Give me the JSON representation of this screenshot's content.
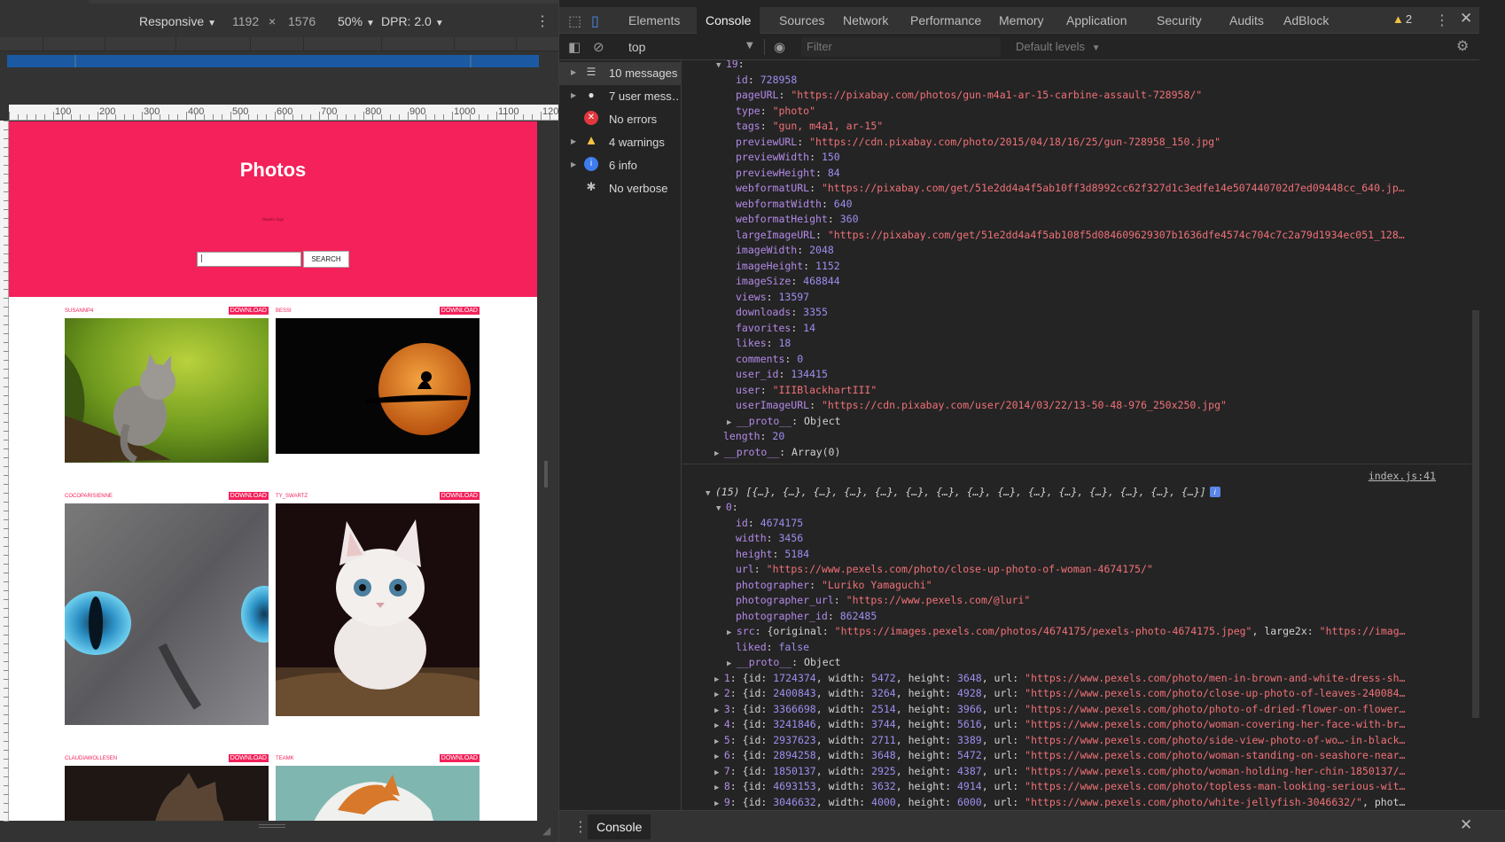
{
  "device_toolbar": {
    "mode": "Responsive",
    "width": "1192",
    "times": "×",
    "height": "1576",
    "zoom": "50%",
    "dpr": "DPR: 2.0"
  },
  "ruler": {
    "labels": [
      "100",
      "200",
      "300",
      "400",
      "500",
      "600",
      "700",
      "800",
      "900",
      "1000",
      "1100",
      "120"
    ]
  },
  "page": {
    "title": "Photos",
    "subtitle": "Header Sign",
    "search_value": "|",
    "search_button": "SEARCH",
    "download_label": "DOWNLOAD",
    "cards": [
      {
        "user": "SUSANNP4",
        "image": "kitten-on-tree"
      },
      {
        "user": "BESSI",
        "image": "cat-moon-silhouette"
      },
      {
        "user": "COCOPARISIENNE",
        "image": "cat-eye-closeup"
      },
      {
        "user": "TY_SWARTZ",
        "image": "white-kitten"
      },
      {
        "user": "CLAUDIAWOLLESEN",
        "image": "dark-cat"
      },
      {
        "user": "TEAMK",
        "image": "ginger-cat"
      }
    ]
  },
  "devtools": {
    "tabs": [
      "Elements",
      "Console",
      "Sources",
      "Network",
      "Performance",
      "Memory",
      "Application",
      "Security",
      "Audits",
      "AdBlock"
    ],
    "active_tab": "Console",
    "warning_count": "2",
    "context": "top",
    "filter_placeholder": "Filter",
    "levels": "Default levels",
    "drawer_tab": "Console"
  },
  "sidebar": {
    "items": [
      {
        "label": "10 messages",
        "icon": "list-icon"
      },
      {
        "label": "7 user mess…",
        "icon": "user-icon"
      },
      {
        "label": "No errors",
        "icon": "error-icon"
      },
      {
        "label": "4 warnings",
        "icon": "warning-icon"
      },
      {
        "label": "6 info",
        "icon": "info-icon"
      },
      {
        "label": "No verbose",
        "icon": "bug-icon"
      }
    ]
  },
  "console": {
    "source_ref": "index.js:41",
    "block1": [
      [
        "19",
        ":",
        ""
      ],
      [
        "id",
        ": ",
        "728958"
      ],
      [
        "pageURL",
        ": ",
        "\"https://pixabay.com/photos/gun-m4a1-ar-15-carbine-assault-728958/\""
      ],
      [
        "type",
        ": ",
        "\"photo\""
      ],
      [
        "tags",
        ": ",
        "\"gun, m4a1, ar-15\""
      ],
      [
        "previewURL",
        ": ",
        "\"https://cdn.pixabay.com/photo/2015/04/18/16/25/gun-728958_150.jpg\""
      ],
      [
        "previewWidth",
        ": ",
        "150"
      ],
      [
        "previewHeight",
        ": ",
        "84"
      ],
      [
        "webformatURL",
        ": ",
        "\"https://pixabay.com/get/51e2dd4a4f5ab10ff3d8992cc62f327d1c3edfe14e507440702d7ed09448cc_640.jp…"
      ],
      [
        "webformatWidth",
        ": ",
        "640"
      ],
      [
        "webformatHeight",
        ": ",
        "360"
      ],
      [
        "largeImageURL",
        ": ",
        "\"https://pixabay.com/get/51e2dd4a4f5ab108f5d084609629307b1636dfe4574c704c7c2a79d1934ec051_128…"
      ],
      [
        "imageWidth",
        ": ",
        "2048"
      ],
      [
        "imageHeight",
        ": ",
        "1152"
      ],
      [
        "imageSize",
        ": ",
        "468844"
      ],
      [
        "views",
        ": ",
        "13597"
      ],
      [
        "downloads",
        ": ",
        "3355"
      ],
      [
        "favorites",
        ": ",
        "14"
      ],
      [
        "likes",
        ": ",
        "18"
      ],
      [
        "comments",
        ": ",
        "0"
      ],
      [
        "user_id",
        ": ",
        "134415"
      ],
      [
        "user",
        ": ",
        "\"IIIBlackhartIII\""
      ],
      [
        "userImageURL",
        ": ",
        "\"https://cdn.pixabay.com/user/2014/03/22/13-50-48-976_250x250.jpg\""
      ],
      [
        "__proto__",
        ": ",
        "Object"
      ],
      [
        "length",
        ": ",
        "20"
      ],
      [
        "__proto__",
        ": ",
        "Array(0)"
      ]
    ],
    "array_summary": "(15) [{…}, {…}, {…}, {…}, {…}, {…}, {…}, {…}, {…}, {…}, {…}, {…}, {…}, {…}, {…}]",
    "block2": [
      [
        "0",
        ":",
        ""
      ],
      [
        "id",
        ": ",
        "4674175"
      ],
      [
        "width",
        ": ",
        "3456"
      ],
      [
        "height",
        ": ",
        "5184"
      ],
      [
        "url",
        ": ",
        "\"https://www.pexels.com/photo/close-up-photo-of-woman-4674175/\""
      ],
      [
        "photographer",
        ": ",
        "\"Luriko Yamaguchi\""
      ],
      [
        "photographer_url",
        ": ",
        "\"https://www.pexels.com/@luri\""
      ],
      [
        "photographer_id",
        ": ",
        "862485"
      ],
      [
        "src",
        ": ",
        "{original: \"https://images.pexels.com/photos/4674175/pexels-photo-4674175.jpeg\", large2x: \"https://imag…"
      ],
      [
        "liked",
        ": ",
        "false"
      ],
      [
        "__proto__",
        ": ",
        "Object"
      ]
    ],
    "rows": [
      "1: {id: 1724374, width: 5472, height: 3648, url: \"https://www.pexels.com/photo/men-in-brown-and-white-dress-sh…",
      "2: {id: 2400843, width: 3264, height: 4928, url: \"https://www.pexels.com/photo/close-up-photo-of-leaves-240084…",
      "3: {id: 3366698, width: 2514, height: 3966, url: \"https://www.pexels.com/photo/photo-of-dried-flower-on-flower…",
      "4: {id: 3241846, width: 3744, height: 5616, url: \"https://www.pexels.com/photo/woman-covering-her-face-with-br…",
      "5: {id: 2937623, width: 2711, height: 3389, url: \"https://www.pexels.com/photo/side-view-photo-of-wo…-in-black…",
      "6: {id: 2894258, width: 3648, height: 5472, url: \"https://www.pexels.com/photo/woman-standing-on-seashore-near…",
      "7: {id: 1850137, width: 2925, height: 4387, url: \"https://www.pexels.com/photo/woman-holding-her-chin-1850137/…",
      "8: {id: 4693153, width: 3632, height: 4914, url: \"https://www.pexels.com/photo/topless-man-looking-serious-wit…",
      "9: {id: 3046632, width: 4000, height: 6000, url: \"https://www.pexels.com/photo/white-jellyfish-3046632/\", phot…"
    ]
  }
}
